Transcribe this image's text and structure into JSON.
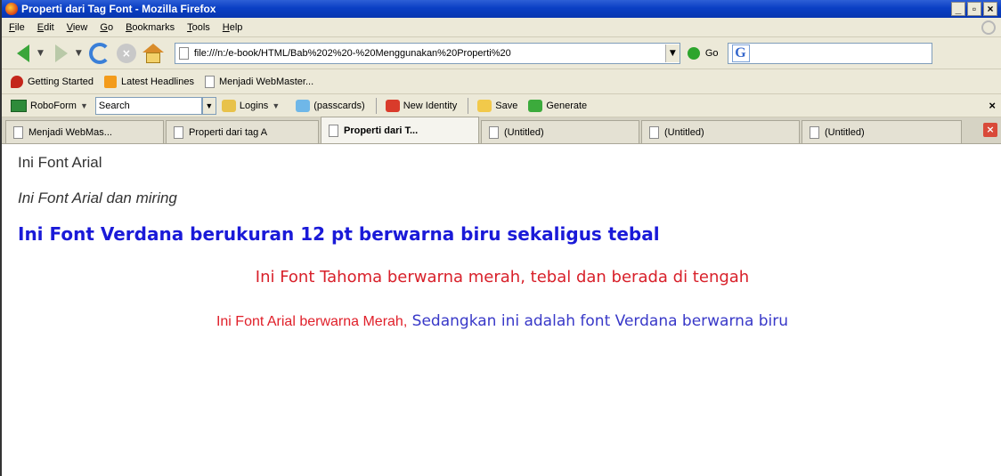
{
  "window": {
    "title": "Properti dari Tag Font - Mozilla Firefox",
    "controls": [
      "_",
      "×"
    ]
  },
  "menubar": {
    "items": [
      "File",
      "Edit",
      "View",
      "Go",
      "Bookmarks",
      "Tools",
      "Help"
    ]
  },
  "navigation": {
    "url": "file:///n:/e-book/HTML/Bab%202%20-%20Menggunakan%20Properti%20",
    "go_label": "Go",
    "search_icon": "G"
  },
  "bookmarks": {
    "items": [
      "Getting Started",
      "Latest Headlines",
      "Menjadi WebMaster..."
    ]
  },
  "roboform": {
    "label": "RoboForm",
    "search_value": "Search",
    "logins": "Logins",
    "passcards": "(passcards)",
    "new_identity": "New Identity",
    "save": "Save",
    "generate": "Generate",
    "close": "×"
  },
  "tabs": [
    {
      "label": "Menjadi WebMas...",
      "active": false
    },
    {
      "label": "Properti dari tag A",
      "active": false
    },
    {
      "label": "Properti dari T...",
      "active": true
    },
    {
      "label": "(Untitled)",
      "active": false
    },
    {
      "label": "(Untitled)",
      "active": false
    },
    {
      "label": "(Untitled)",
      "active": false
    }
  ],
  "content": {
    "line1": "Ini Font Arial",
    "line2": "Ini Font Arial dan miring",
    "line3": "Ini Font Verdana berukuran 12 pt berwarna biru sekaligus tebal",
    "line4": "Ini Font Tahoma berwarna merah, tebal dan berada di tengah",
    "line5_red": "Ini Font Arial berwarna Merah,",
    "line5_blue": " Sedangkan ini adalah font Verdana berwarna biru"
  },
  "colors": {
    "titlebar": "#0a3fc4",
    "blue_text": "#1a1ad8",
    "red_text": "#d8202a"
  }
}
